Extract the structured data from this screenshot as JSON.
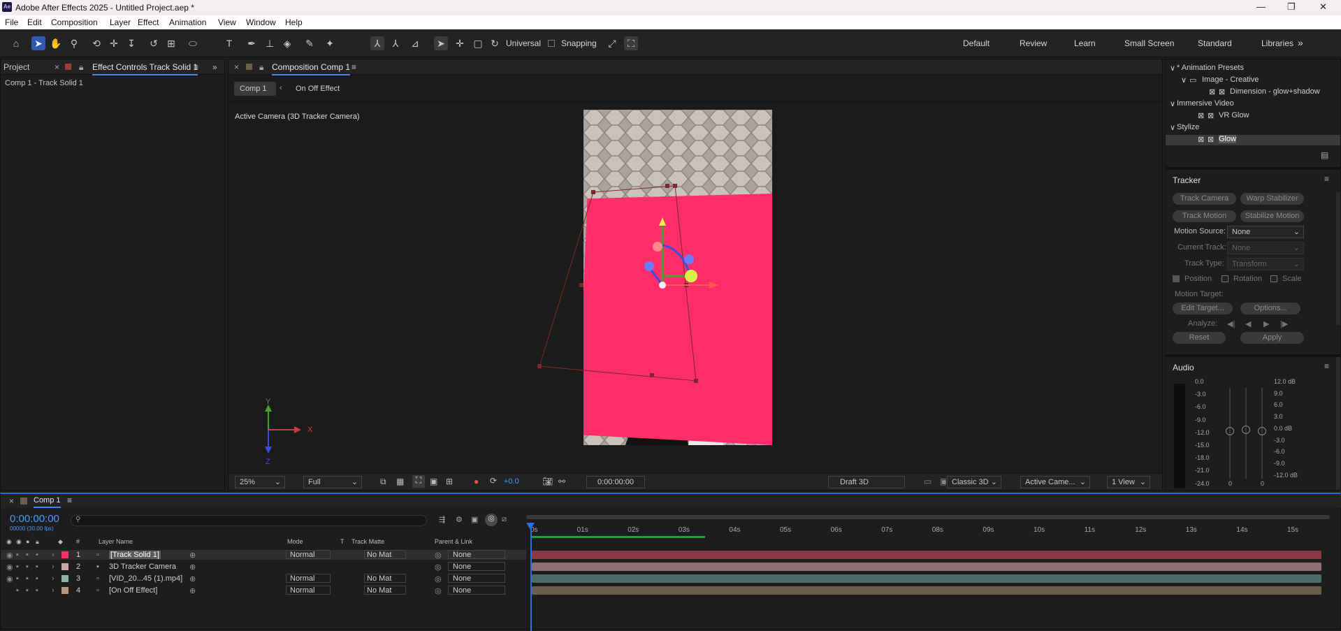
{
  "app": {
    "title": "Adobe After Effects 2025 - Untitled Project.aep *",
    "logo": "Ae"
  },
  "window_controls": {
    "minimize": "—",
    "maximize": "❐",
    "close": "✕"
  },
  "menu": [
    "File",
    "Edit",
    "Composition",
    "Layer",
    "Effect",
    "Animation",
    "View",
    "Window",
    "Help"
  ],
  "toolbar": {
    "tools": [
      "home-icon",
      "selection-icon",
      "hand-icon",
      "zoom-icon",
      "orbit-camera-icon",
      "pan-camera-icon",
      "dolly-camera-icon",
      "rotate-icon",
      "pan-behind-icon",
      "ellipse-icon",
      "type-icon",
      "pen-icon",
      "clone-stamp-icon",
      "eraser-icon",
      "roto-brush-icon",
      "puppet-icon"
    ],
    "axis_mode_label": "Universal",
    "snapping_label": "Snapping",
    "workspaces": [
      "Default",
      "Review",
      "Learn",
      "Small Screen",
      "Standard",
      "Libraries"
    ],
    "more": "»"
  },
  "left_panel": {
    "tab_project": "Project",
    "tab_effect_controls": "Effect Controls Track Solid 1",
    "breadcrumb": "Comp 1 - Track Solid 1"
  },
  "comp_panel": {
    "tab": "Composition Comp 1",
    "nav_items": [
      "Comp 1",
      "On Off Effect"
    ],
    "camera_label": "Active Camera (3D Tracker Camera)",
    "axis_labels": {
      "x": "X",
      "y": "Y",
      "z": "Z"
    },
    "footer": {
      "zoom": "25%",
      "resolution": "Full",
      "exposure": "+0.0",
      "timecode": "0:00:00:00",
      "renderer_draft": "Draft 3D",
      "renderer": "Classic 3D",
      "view": "Active Came...",
      "views": "1 View"
    }
  },
  "right_panel": {
    "effects_tree": [
      {
        "label": "* Animation Presets",
        "indent": 0,
        "caret": "∨"
      },
      {
        "label": "Image - Creative",
        "indent": 1,
        "caret": "∨",
        "icon": "folder-icon"
      },
      {
        "label": "Dimension - glow+shadow",
        "indent": 2,
        "caret": "",
        "icon": "preset-icon"
      },
      {
        "label": "Immersive Video",
        "indent": 0,
        "caret": "∨"
      },
      {
        "label": "VR Glow",
        "indent": 1,
        "caret": "",
        "icon": "effect-icon"
      },
      {
        "label": "Stylize",
        "indent": 0,
        "caret": "∨"
      },
      {
        "label": "Glow",
        "indent": 1,
        "caret": "",
        "icon": "effect-icon",
        "selected": true
      }
    ],
    "tracker": {
      "title": "Tracker",
      "buttons": [
        "Track Camera",
        "Warp Stabilizer",
        "Track Motion",
        "Stabilize Motion"
      ],
      "motion_source_label": "Motion Source:",
      "motion_source": "None",
      "current_track_label": "Current Track:",
      "current_track": "None",
      "track_type_label": "Track Type:",
      "track_type": "Transform",
      "position_label": "Position",
      "rotation_label": "Rotation",
      "scale_label": "Scale",
      "motion_target_label": "Motion Target:",
      "edit_target": "Edit Target...",
      "options": "Options...",
      "analyze_label": "Analyze:",
      "analyze_icons": [
        "◀|",
        "◀",
        "▶",
        "|▶"
      ],
      "reset": "Reset",
      "apply": "Apply"
    },
    "audio": {
      "title": "Audio",
      "left_scale": [
        "0.0",
        "-3.0",
        "-6.0",
        "-9.0",
        "-12.0",
        "-15.0",
        "-18.0",
        "-21.0",
        "-24.0"
      ],
      "right_scale": [
        "12.0 dB",
        "9.0",
        "6.0",
        "3.0",
        "0.0 dB",
        "-3.0",
        "-6.0",
        "-9.0",
        "-12.0 dB"
      ],
      "knob_values": [
        "0",
        "0"
      ]
    }
  },
  "timeline": {
    "tab": "Comp 1",
    "timecode": "0:00:00:00",
    "fps": "00000 (30.00 fps)",
    "search_placeholder": "",
    "columns": {
      "name": "Layer Name",
      "number": "#",
      "mode": "Mode",
      "t": "T",
      "track_matte": "Track Matte",
      "parent": "Parent & Link"
    },
    "ruler": [
      "0s",
      "01s",
      "02s",
      "03s",
      "04s",
      "05s",
      "06s",
      "07s",
      "08s",
      "09s",
      "10s",
      "11s",
      "12s",
      "13s",
      "14s",
      "15s"
    ],
    "layers": [
      {
        "num": "1",
        "name": "[Track Solid 1]",
        "label_color": "#ff2e6b",
        "mode": "Normal",
        "matte": "No Mat",
        "parent": "None",
        "bar_color": "#8a3a44",
        "selected": true
      },
      {
        "num": "2",
        "name": "3D Tracker Camera",
        "label_color": "#c9a6a6",
        "mode": "",
        "matte": "",
        "parent": "None",
        "bar_color": "#8f6d74"
      },
      {
        "num": "3",
        "name": "[VID_20...45 (1).mp4]",
        "label_color": "#8cb0aa",
        "mode": "Normal",
        "matte": "No Mat",
        "parent": "None",
        "bar_color": "#4d6b6b"
      },
      {
        "num": "4",
        "name": "[On Off Effect]",
        "label_color": "#b3977a",
        "mode": "Normal",
        "matte": "No Mat",
        "parent": "None",
        "bar_color": "#6b5e4c"
      }
    ]
  }
}
